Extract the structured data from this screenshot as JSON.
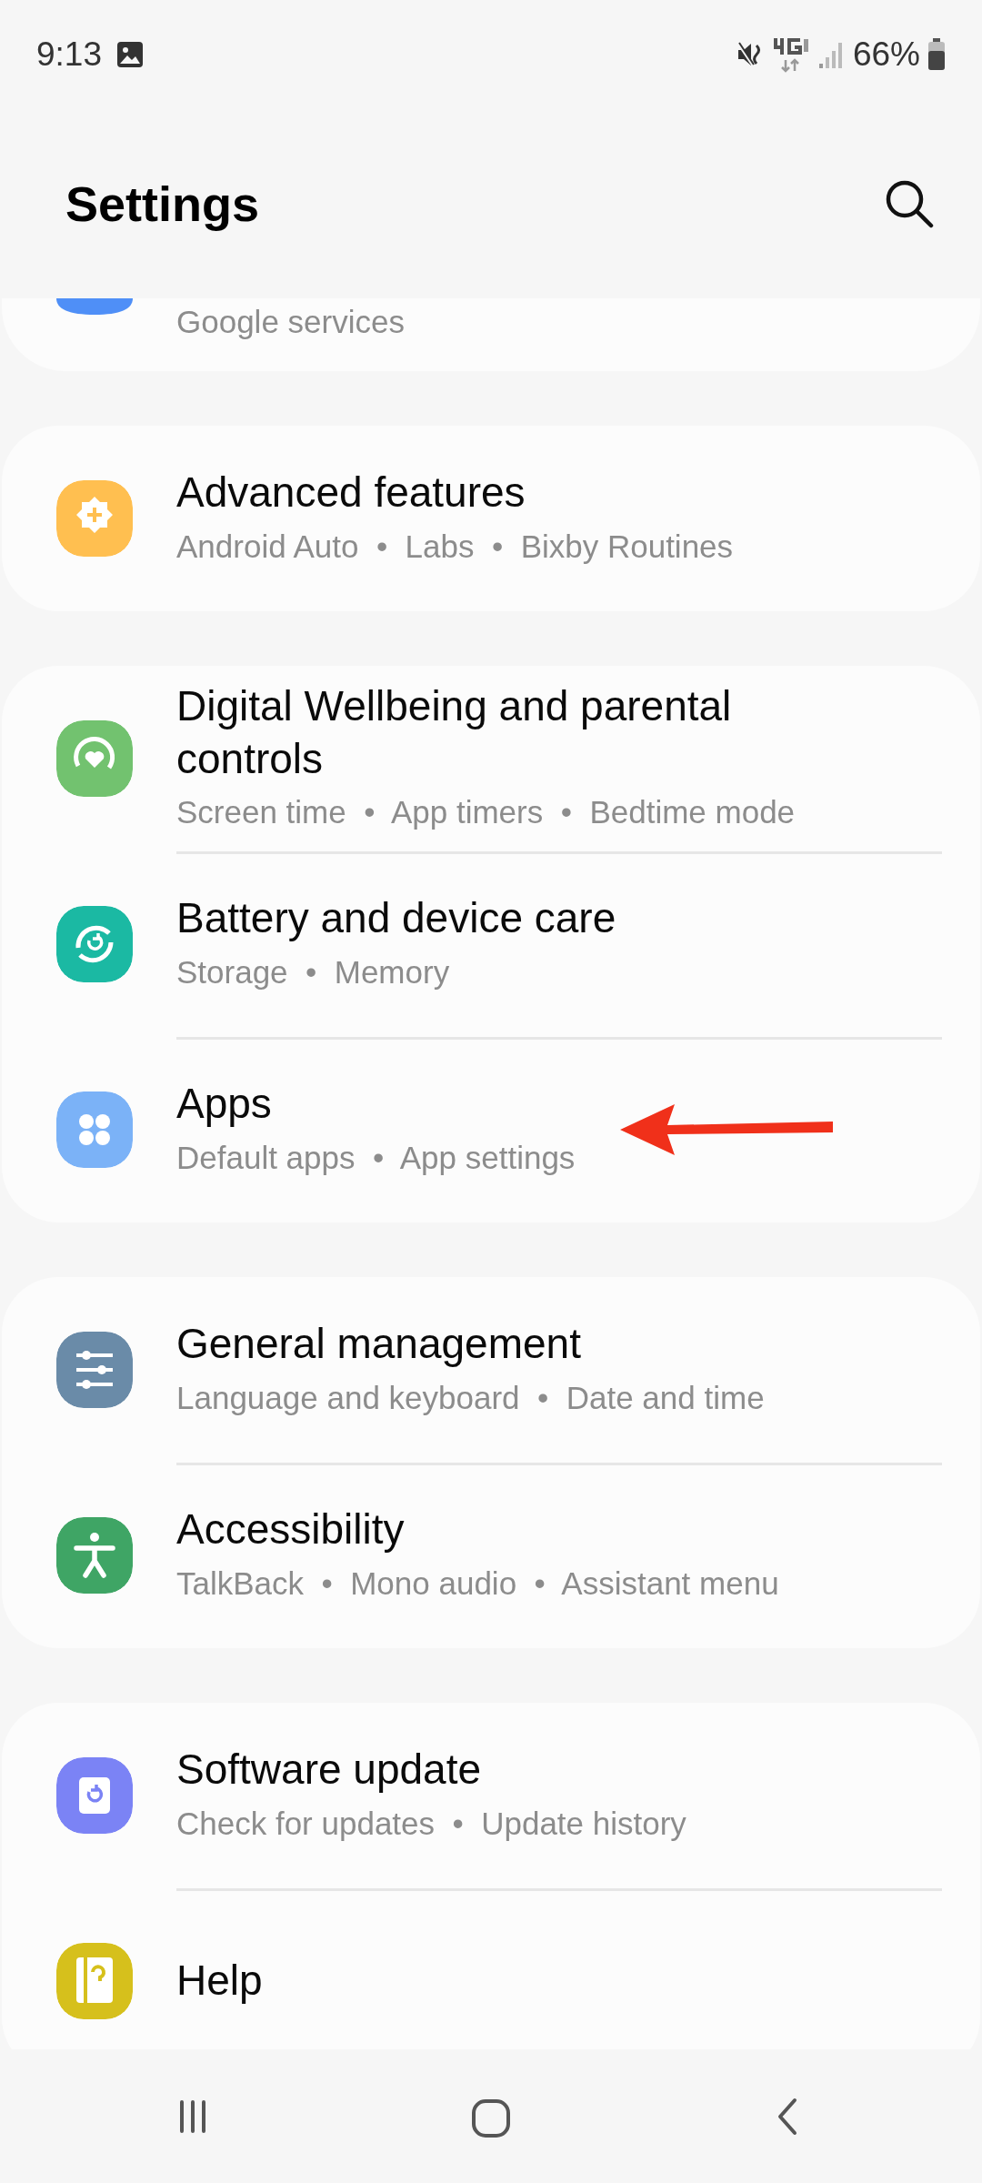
{
  "status_bar": {
    "time": "9:13",
    "battery": "66%"
  },
  "header": {
    "title": "Settings"
  },
  "groups": [
    {
      "items": [
        {
          "subtitle": "Google services",
          "color": "#4f8ff7",
          "arrow": false
        }
      ]
    },
    {
      "items": [
        {
          "title": "Advanced features",
          "subtitle": "Android Auto  •  Labs  •  Bixby Routines",
          "color": "#ffbf50",
          "arrow": false
        }
      ]
    },
    {
      "items": [
        {
          "title": "Digital Wellbeing and parental controls",
          "subtitle": "Screen time  •  App timers  •  Bedtime mode",
          "color": "#72c26f",
          "arrow": false
        },
        {
          "title": "Battery and device care",
          "subtitle": "Storage  •  Memory",
          "color": "#1bb9a3",
          "arrow": false
        },
        {
          "title": "Apps",
          "subtitle": "Default apps  •  App settings",
          "color": "#7bb2f7",
          "arrow": true
        }
      ]
    },
    {
      "items": [
        {
          "title": "General management",
          "subtitle": "Language and keyboard  •  Date and time",
          "color": "#6a8ba8",
          "arrow": false
        },
        {
          "title": "Accessibility",
          "subtitle": "TalkBack  •  Mono audio  •  Assistant menu",
          "color": "#3fa565",
          "arrow": false
        }
      ]
    },
    {
      "items": [
        {
          "title": "Software update",
          "subtitle": "Check for updates  •  Update history",
          "color": "#7b83f5",
          "arrow": false
        },
        {
          "title": "Help",
          "color": "#d6c01c",
          "arrow": false
        }
      ]
    }
  ]
}
